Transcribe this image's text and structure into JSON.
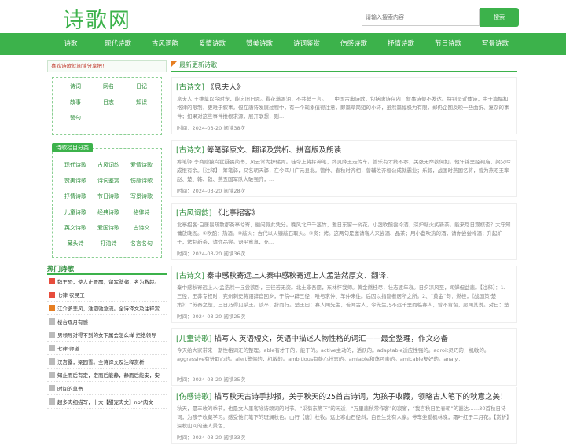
{
  "site": {
    "logo": "诗歌网",
    "search_placeholder": "请输入搜索内容",
    "search_button": "搜索"
  },
  "nav": [
    "诗歌",
    "现代诗歌",
    "古风词韵",
    "爱情诗歌",
    "赞美诗歌",
    "诗词鉴赏",
    "伤感诗歌",
    "抒情诗歌",
    "节日诗歌",
    "写景诗歌"
  ],
  "sidebar": {
    "share_text": "喜欢诗歌就阅读分享把！",
    "categories": [
      "诗词",
      "网名",
      "日记",
      "故事",
      "日志",
      "知识",
      "警句"
    ],
    "column_title": "诗歌栏目分类",
    "columns": [
      "现代诗歌",
      "古风词韵",
      "爱情诗歌",
      "赞美诗歌",
      "诗词鉴赏",
      "伤感诗歌",
      "抒情诗歌",
      "节日诗歌",
      "写景诗歌",
      "儿童诗歌",
      "经典诗歌",
      "格律诗",
      "英文诗歌",
      "爱国诗歌",
      "古诗文",
      "藏头诗",
      "打油诗",
      "名言名句"
    ],
    "hot_title": "热门诗歌",
    "hot_items": [
      "魏王恐，使人止晋鄙，留军壁邺，名为救赵。",
      "七律·农民工",
      "江介多悲风，淮泗驰急流。全诗译文及注释赏",
      "楼台观月有感",
      "男领导对得不到的女下属会怎么样 拒绝领导",
      "七律·师道",
      "汉宫露，梁园雪。全诗译文及注释赏析",
      "知止而后有定，定而后能静，静而后能安，安",
      "时间的草书",
      "超多肉细描写，十大【甜宠肉文】np*肉文"
    ],
    "hot_colors": [
      "#e74c3c",
      "#e74c3c",
      "#e67e22",
      "#bbbbbb",
      "#bbbbbb",
      "#bbbbbb",
      "#bbbbbb",
      "#bbbbbb",
      "#bbbbbb",
      "#bbbbbb"
    ]
  },
  "main": {
    "latest_title": "最新更新诗歌",
    "articles": [
      {
        "category": "[古诗文]",
        "title": "《息夫人》",
        "body": "息夫人·王维莫以今时宠，能忘旧日恩。看花满眼泪，不共楚王言。　　中国古典诗歌，包括唐诗在内，叙事诗很不发达。特别是近体诗，由于篇幅和格律的限制，更难于叙事。但在唐诗发展过程中，有一个现象值得注意，即篇章简短的小诗，虽然篇幅极为有限，却仍企图反映一些曲折、复杂的事件；如果对这些事件推根求源，展开联想，则...",
        "date": "时间：2024-03-20",
        "views": "阅读38次"
      },
      {
        "category": "[古诗文]",
        "title": "筹笔驿原文、翻译及赏析、拼音版及朗读",
        "body": "筹笔驿·李商隐猿鸟犹疑畏简书，风云常为护储胥。徒令上将挥神笔，终见降王走传车。管乐有才终不忝，关张无命欲何如。他年锦里经祠庙，梁父吟成恨有余。【注释】：筹笔驿，又名朝天驿，在今四川广元县北。管仲、春秋时齐相，曾辅佐齐桓公成就霸业；乐毅，战国时燕国名将，曾为燕昭王率赵、楚、韩、魏、燕五国军队大破强齐，...",
        "date": "时间：2024-03-20",
        "views": "阅读28次"
      },
      {
        "category": "[古风词韵]",
        "title": "《北亭招客》",
        "body": "北亭招客·白居易疏散郡斋亭兮寄，幽闲竟此凭分。晚风北户千茎竹，雅日东窗一树花。小盏吹醅尝冷酒，深炉敲火炙新茶。能来尽日观棋否？太守知慵放晚衙。①吹醅：热酒。②敲火：古代以火镰敲石取火。③炙：烤。这两句是邀请客人来尝酒、品茶；用小盏吹热的酒，请你尝尝冷酒；升起炉子，烤制新茶，请你品尝。语平意真，充...",
        "date": "时间：2024-03-20",
        "views": "阅读36次"
      },
      {
        "category": "[古诗文]",
        "title": "秦中感秋寄远上人秦中感秋寄远上人孟浩然原文、翻译、",
        "body": "秦中感秋寄远上人·孟浩然一丘尝欲卧，三径苦无资。北土非吾愿，东林怀我师。黄金燃桂尽，壮志逐年衰。日夕凉风至，闻蝉但益悲。【注释】：1、三径：王莽专权时，兖州刺史蒋诩辞官回乡，于院中辟三径，唯与求仲、羊仲来往。后因以指隐者居所之所。2、“黄金”句：燃桂，《战国策·楚策》：“苏秦之楚，三日乃得见乎王。谈卒，辞而行。楚王曰：寡人闻先生，若闻古人，今先生乃不远千里而临寡人，曾不肯留，愿闻其说。对曰：楚国之食贵于玉，薪贵于桂，谒者难得见如鬼，王难得见如天帝。今令臣食玉炊桂，因鬼见帝。”后以“燃桂”指物价昂贵的地方。3、逐：《全唐诗》作“任”。因上人之诗，而有归隐之意，诗中反映出诗人仕途失意，怀才不遇、迫于生计而滞留长安的悲凉心情。黄金燃桂尽，壮志逐年衰。可见其生活拮据、志意消沉的凄苦之状。【翻译】：我...",
        "date": "时间：2024-03-20",
        "views": "阅读25次"
      },
      {
        "category": "[儿童诗歌]",
        "title": "描写人 英语短文，英语中描述人物性格的词汇——最全整理，作文必备",
        "body": "今天给大家带来一期性格词汇的整理。able有才干的，能干的。active主动的，活跃的。adaptable适应性强的。adroit灵巧的，机敏的。aggressive有进取心的。alert警惕的，机敏的。ambitious有雄心壮志的。amiable和蔼可亲的。amicable友好的。analy...",
        "date": "时间：2024-03-20",
        "views": "阅读35次"
      },
      {
        "category": "[伤感诗歌]",
        "title": "描写秋天古诗手抄报，关于秋天的25首古诗词，为孩子收藏，领略古人笔下的秋意之美！",
        "body": "秋天，是丰收的季节，也是文人墨客咏诗颂词的时节。“采菊东篱下”的闲适，“万里悲秋常作客”的寂寥，“我言秋日胜春朝”的豁达……30首秋日诗词，为孩子收藏学习。感受他们笔下的斑斓秋色。山行【唐】杜牧。远上寒山石径斜，白云生处有人家。停车坐爱枫林晚，霜叶红于二月花。【赏析】深秋山间的迷人景色，",
        "date": "时间：2024-03-20",
        "views": "阅读33次"
      }
    ]
  },
  "colors": {
    "brand": "#3cb24b",
    "accent": "#e67e22"
  }
}
